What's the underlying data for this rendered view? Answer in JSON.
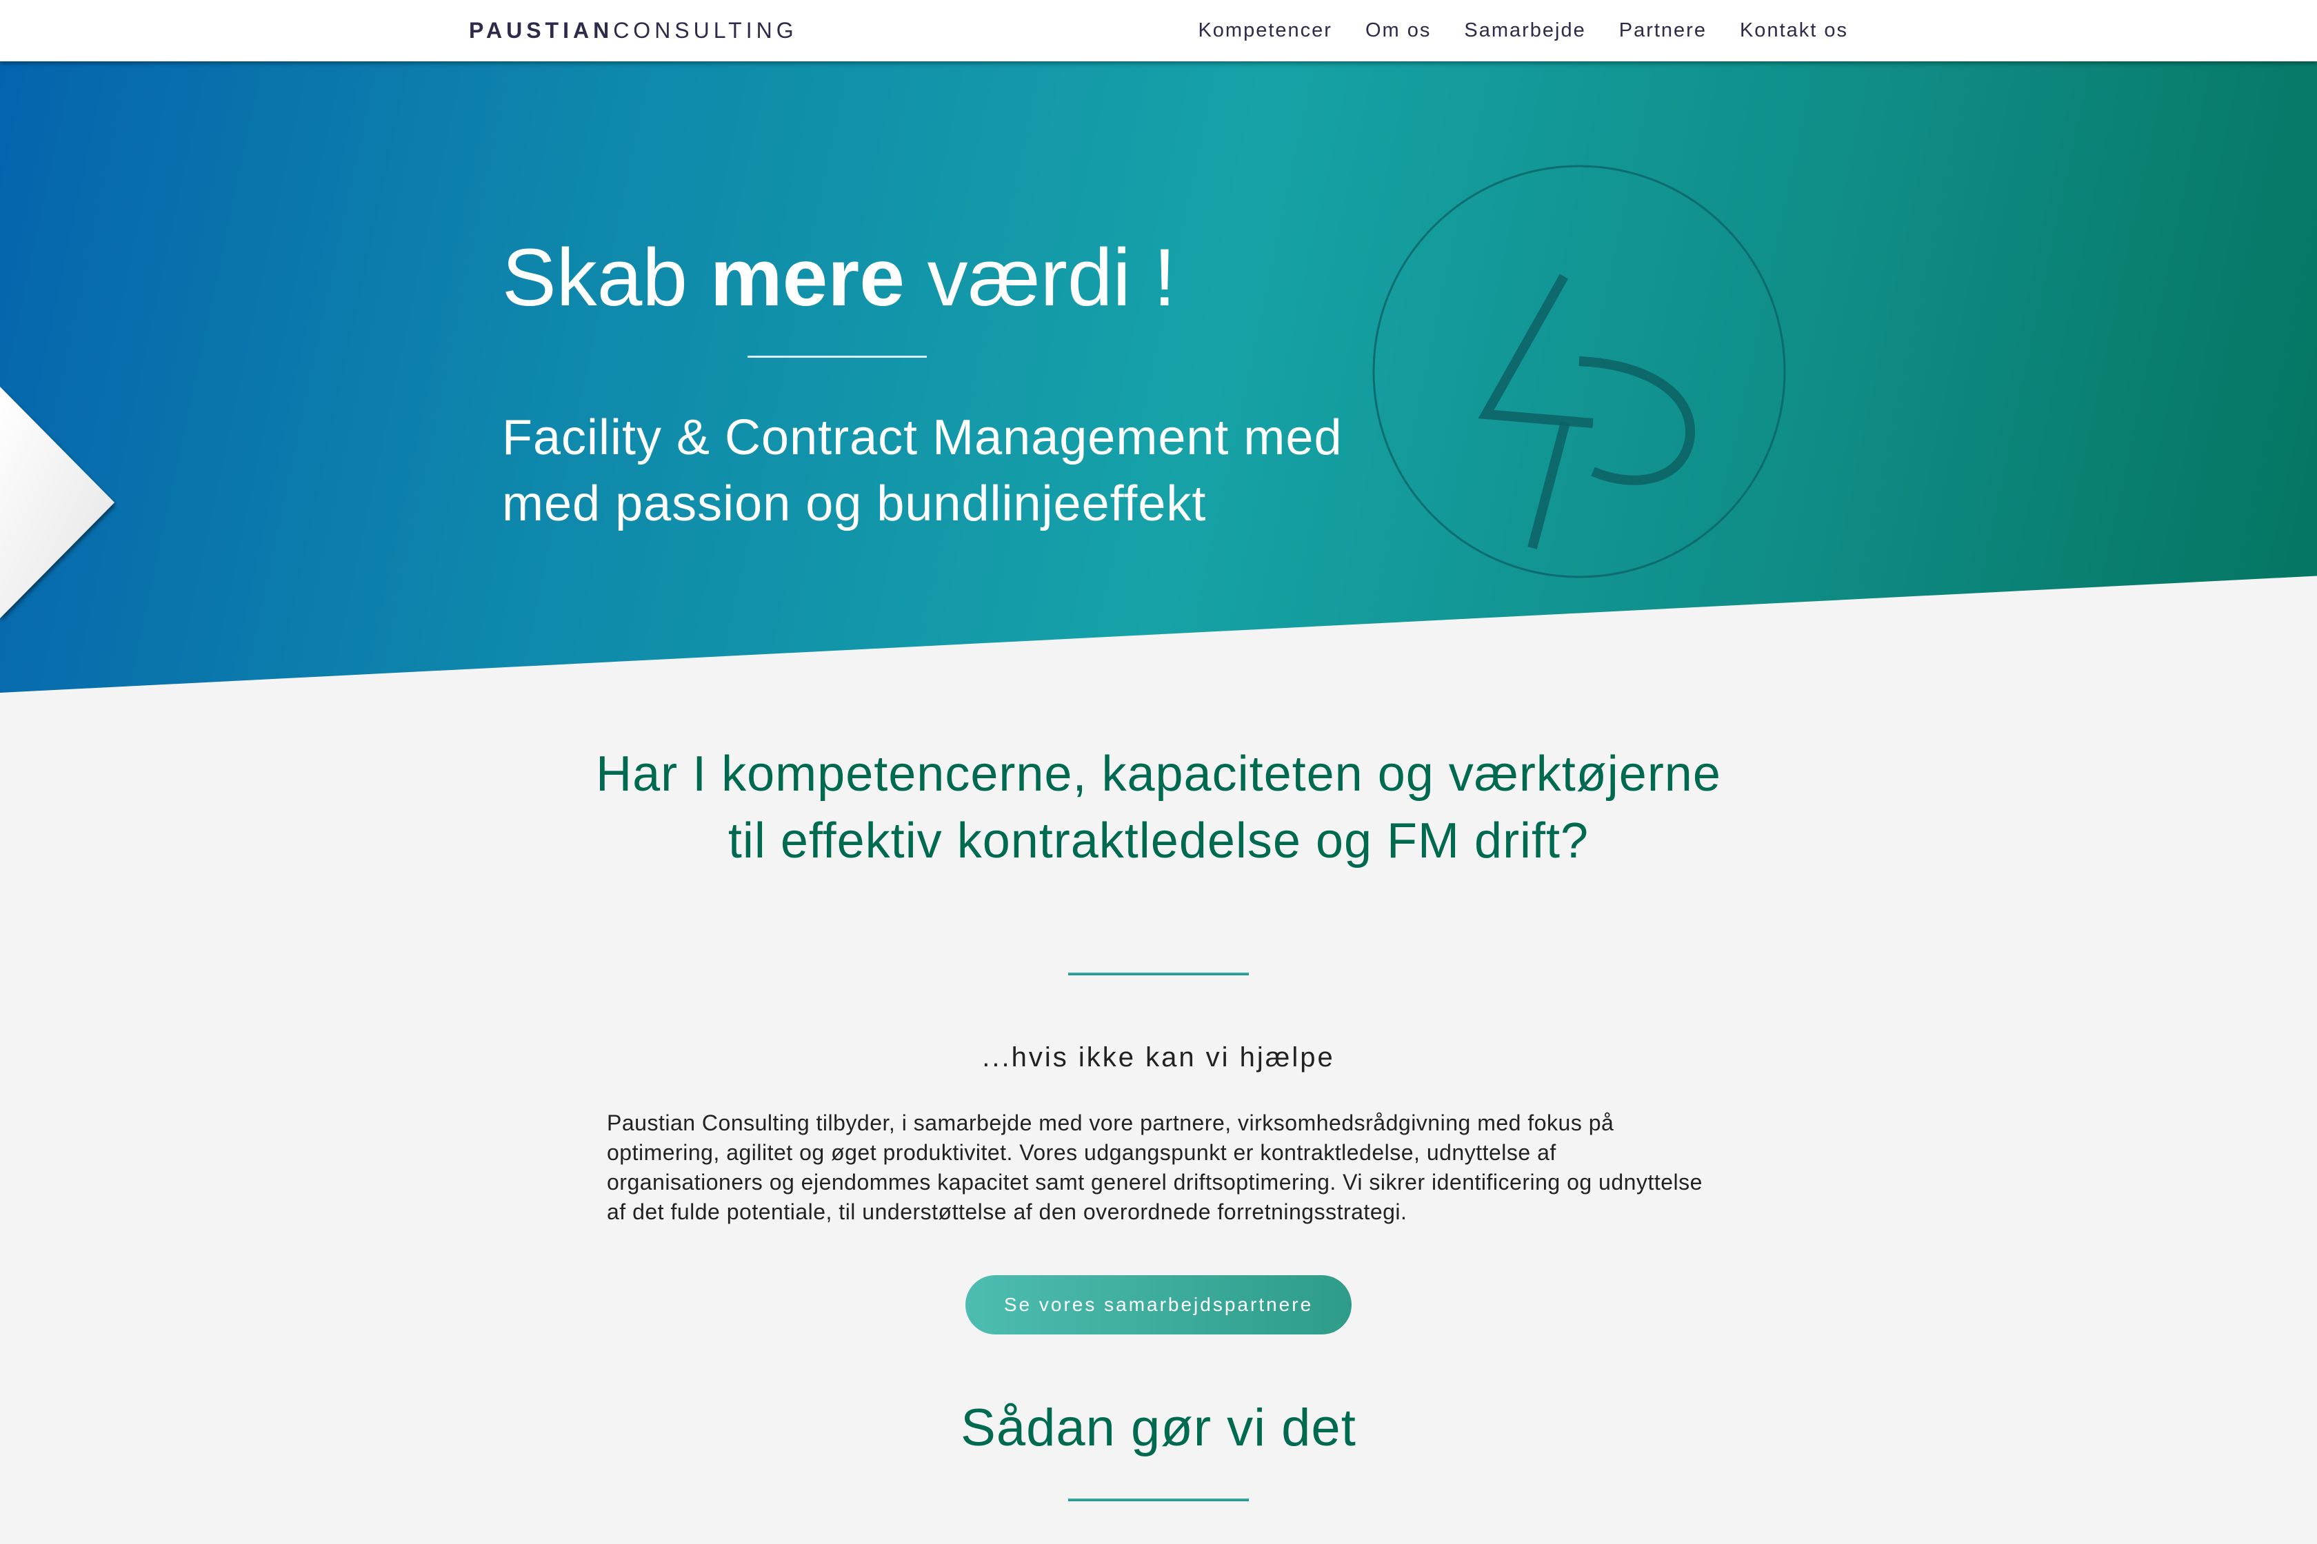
{
  "brand": {
    "bold": "PAUSTIAN",
    "light": "CONSULTING"
  },
  "nav": [
    {
      "label": "Kompetencer"
    },
    {
      "label": "Om os"
    },
    {
      "label": "Samarbejde"
    },
    {
      "label": "Partnere"
    },
    {
      "label": "Kontakt os"
    }
  ],
  "hero": {
    "title_pre": "Skab ",
    "title_bold": "mere",
    "title_post": " værdi !",
    "subtitle_line1": "Facility & Contract Management med",
    "subtitle_line2": "med passion og bundlinjeeffekt",
    "emblem_icon": "lp-monogram-icon"
  },
  "intro": {
    "heading": "Har I kompetencerne, kapaciteten og værktøjerne til effektiv kontraktledelse og FM drift?",
    "tagline": "...hvis ikke kan vi hjælpe",
    "body": "Paustian Consulting tilbyder, i samarbejde med vore partnere, virksomhedsrådgivning med fokus på optimering, agilitet og øget produktivitet. Vores udgangspunkt er kontraktledelse, udnyttelse af organisationers og ejendommes kapacitet samt generel driftsoptimering. Vi sikrer identificering og udnyttelse af det fulde potentiale, til understøttelse af den overordnede forretningsstrategi.",
    "cta_label": "Se vores samarbejdspartnere"
  },
  "how": {
    "heading": "Sådan gør vi det"
  },
  "colors": {
    "hero_start": "#0563ad",
    "hero_mid": "#16a2a7",
    "hero_end": "#047460",
    "heading_green": "#006a50",
    "button_start": "#4dbdb1",
    "button_end": "#2f9c89",
    "nav_text": "#2d2a4a",
    "page_bg": "#f4f4f4"
  }
}
